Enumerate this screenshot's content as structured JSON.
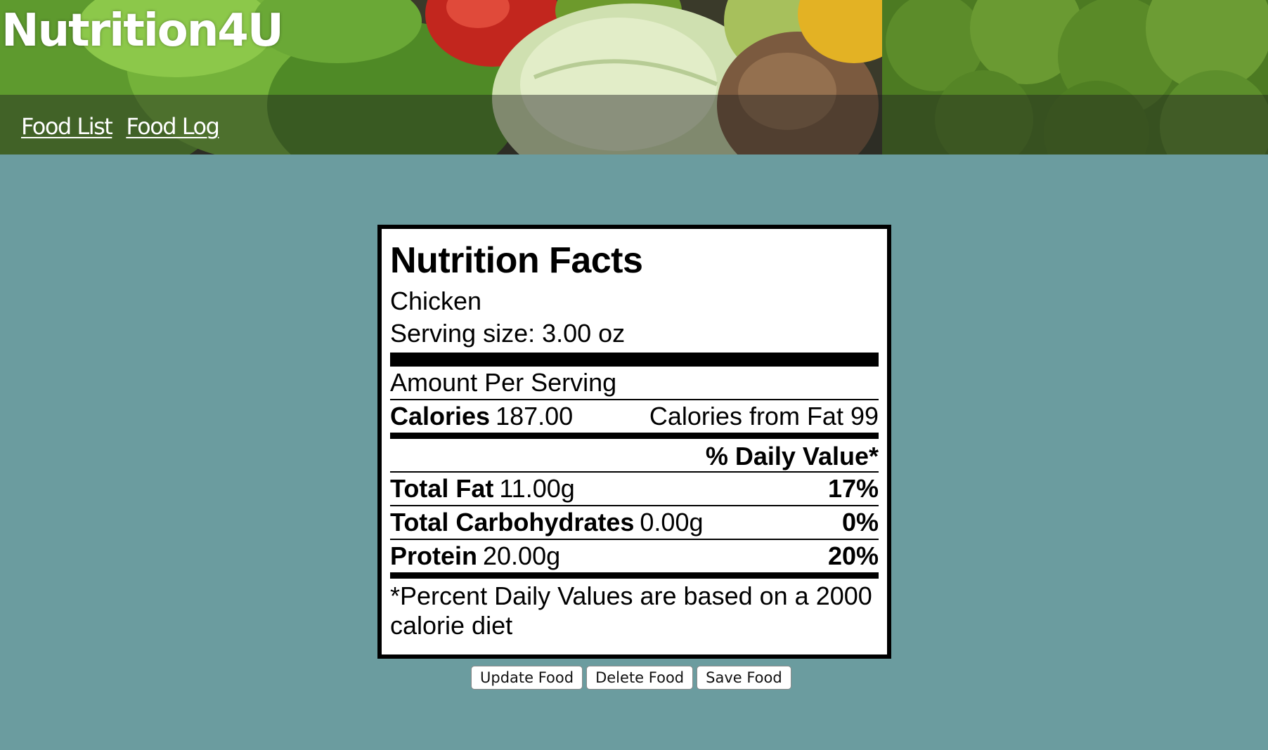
{
  "header": {
    "site_title": "Nutrition4U",
    "banner_image": "vegetables-banner",
    "nav": [
      {
        "label": "Food List"
      },
      {
        "label": "Food Log"
      }
    ]
  },
  "label": {
    "title": "Nutrition Facts",
    "food_name": "Chicken",
    "serving_size": "Serving size: 3.00 oz",
    "amount_per_serving": "Amount Per Serving",
    "calories_label": "Calories",
    "calories_value": "187.00",
    "calories_from_fat": "Calories from Fat 99",
    "daily_value_header": "% Daily Value*",
    "nutrients": [
      {
        "name": "Total Fat",
        "amount": "11.00g",
        "dv": "17%"
      },
      {
        "name": "Total Carbohydrates",
        "amount": "0.00g",
        "dv": "0%"
      },
      {
        "name": "Protein",
        "amount": "20.00g",
        "dv": "20%"
      }
    ],
    "footnote": "*Percent Daily Values are based on a 2000 calorie diet"
  },
  "buttons": {
    "update": "Update Food",
    "delete": "Delete Food",
    "save": "Save Food"
  },
  "colors": {
    "page_background": "#6b9c9f",
    "label_background": "#ffffff",
    "label_border": "#000000"
  }
}
